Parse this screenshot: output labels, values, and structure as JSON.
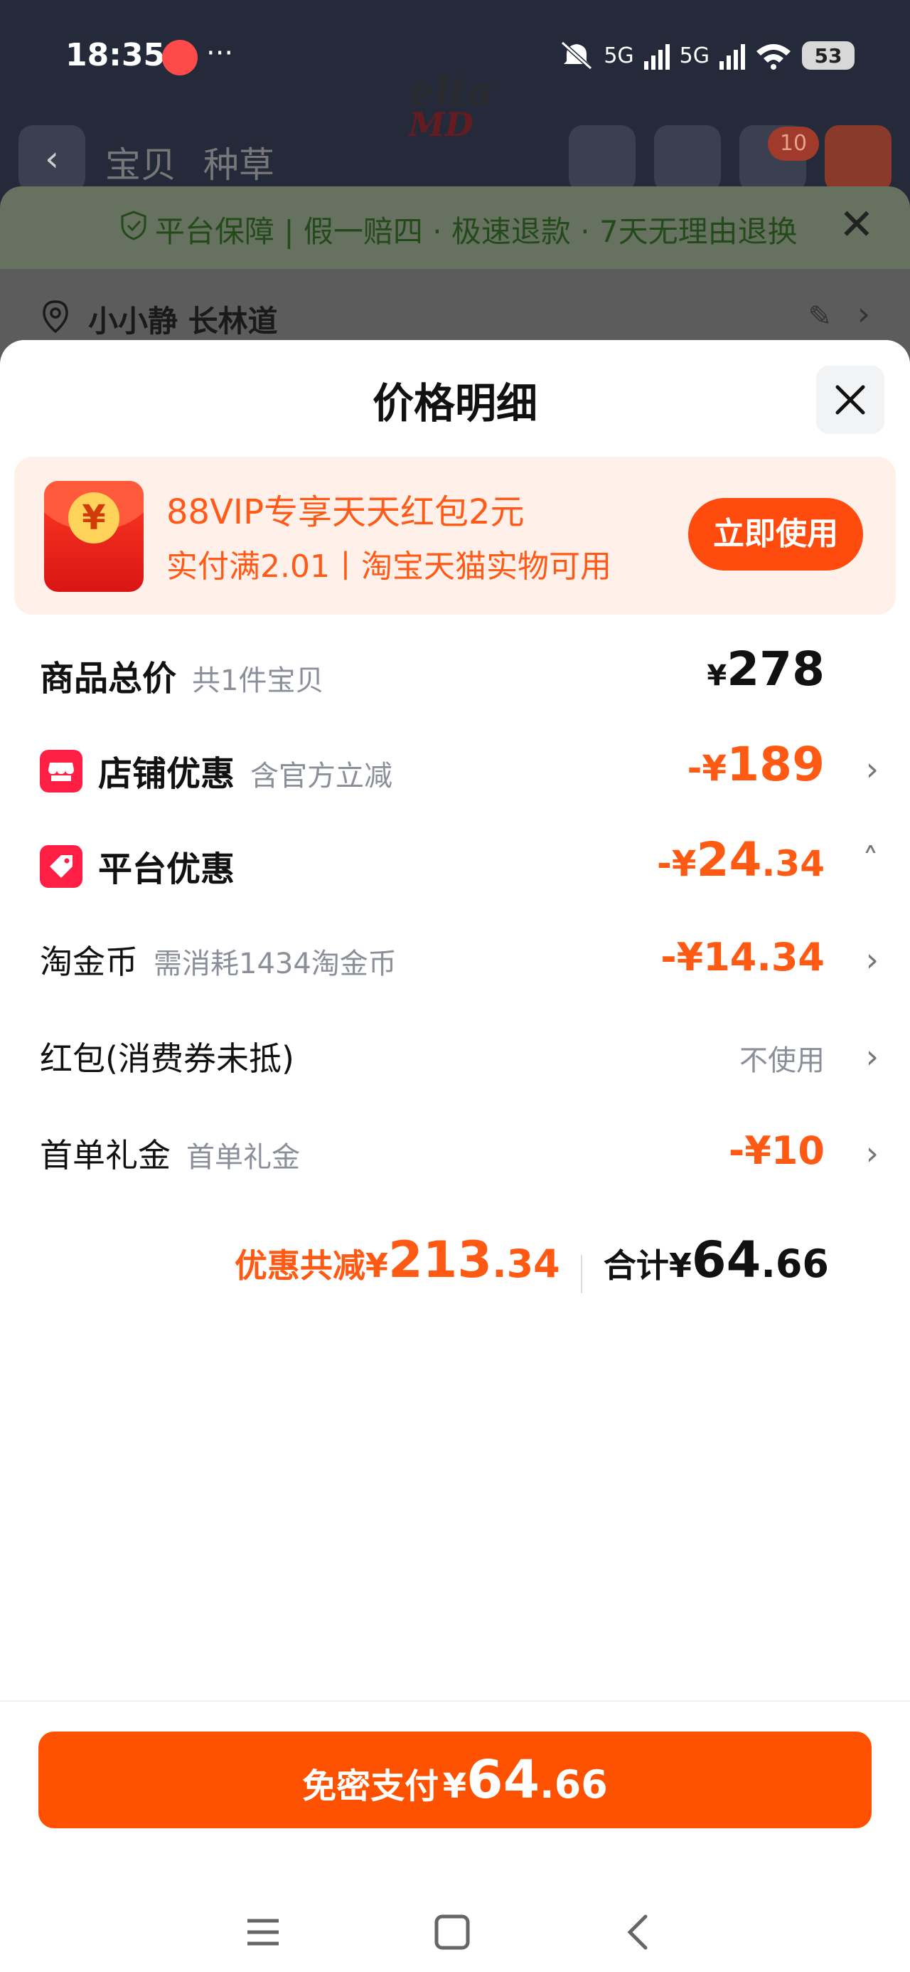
{
  "status_bar": {
    "time": "18:35",
    "dots": "···",
    "net1": "5G",
    "net2": "5G",
    "battery": "53"
  },
  "background_page": {
    "brand_logo": "elta",
    "brand_logo_sub": "MD",
    "tabs": [
      "宝贝",
      "种草"
    ],
    "cart_count": "10",
    "guarantee_text": "平台保障 | 假一赔四 · 极速退款 · 7天无理由退换",
    "address": "小小静 长林道"
  },
  "sheet": {
    "title": "价格明细",
    "coupon": {
      "title": "88VIP专享天天红包2元",
      "subtitle": "实付满2.01丨淘宝天猫实物可用",
      "button": "立即使用"
    },
    "rows": {
      "goods_total": {
        "label": "商品总价",
        "hint": "共1件宝贝",
        "currency": "¥",
        "value": "278"
      },
      "shop_discount": {
        "label": "店铺优惠",
        "hint": "含官方立减",
        "value_prefix": "-¥",
        "value": "189"
      },
      "platform_discount": {
        "label": "平台优惠",
        "value_prefix": "-¥",
        "value_int": "24",
        "value_dec": ".34"
      },
      "taojinbi": {
        "label": "淘金币",
        "hint": "需消耗1434淘金币",
        "value": "-¥14.34"
      },
      "red_packet": {
        "label": "红包(消费券未抵)",
        "value": "不使用"
      },
      "first_gift": {
        "label": "首单礼金",
        "hint": "首单礼金",
        "value": "-¥10"
      }
    },
    "summary": {
      "save_label": "优惠共减",
      "save_currency": "¥",
      "save_int": "213",
      "save_dec": ".34",
      "total_label": "合计",
      "total_currency": "¥",
      "total_int": "64",
      "total_dec": ".66"
    },
    "pay_button": {
      "label": "免密支付",
      "currency": "¥",
      "amount_int": "64",
      "amount_dec": ".66"
    }
  },
  "colors": {
    "accent": "#ff5200",
    "discount_text": "#ff5a14",
    "coupon_bg": "#fff1ea",
    "badge_red": "#ff1e44"
  },
  "icons": [
    "app-notification-icon",
    "mute-icon",
    "signal-icon",
    "wifi-icon",
    "battery-icon",
    "back-icon",
    "search-icon",
    "share-icon",
    "cart-icon",
    "more-icon",
    "shield-check-icon",
    "close-icon",
    "location-pin-icon",
    "edit-icon",
    "chevron-right-icon",
    "red-envelope-icon",
    "shop-icon",
    "tag-icon",
    "chevron-up-icon",
    "menu-icon",
    "home-icon"
  ]
}
